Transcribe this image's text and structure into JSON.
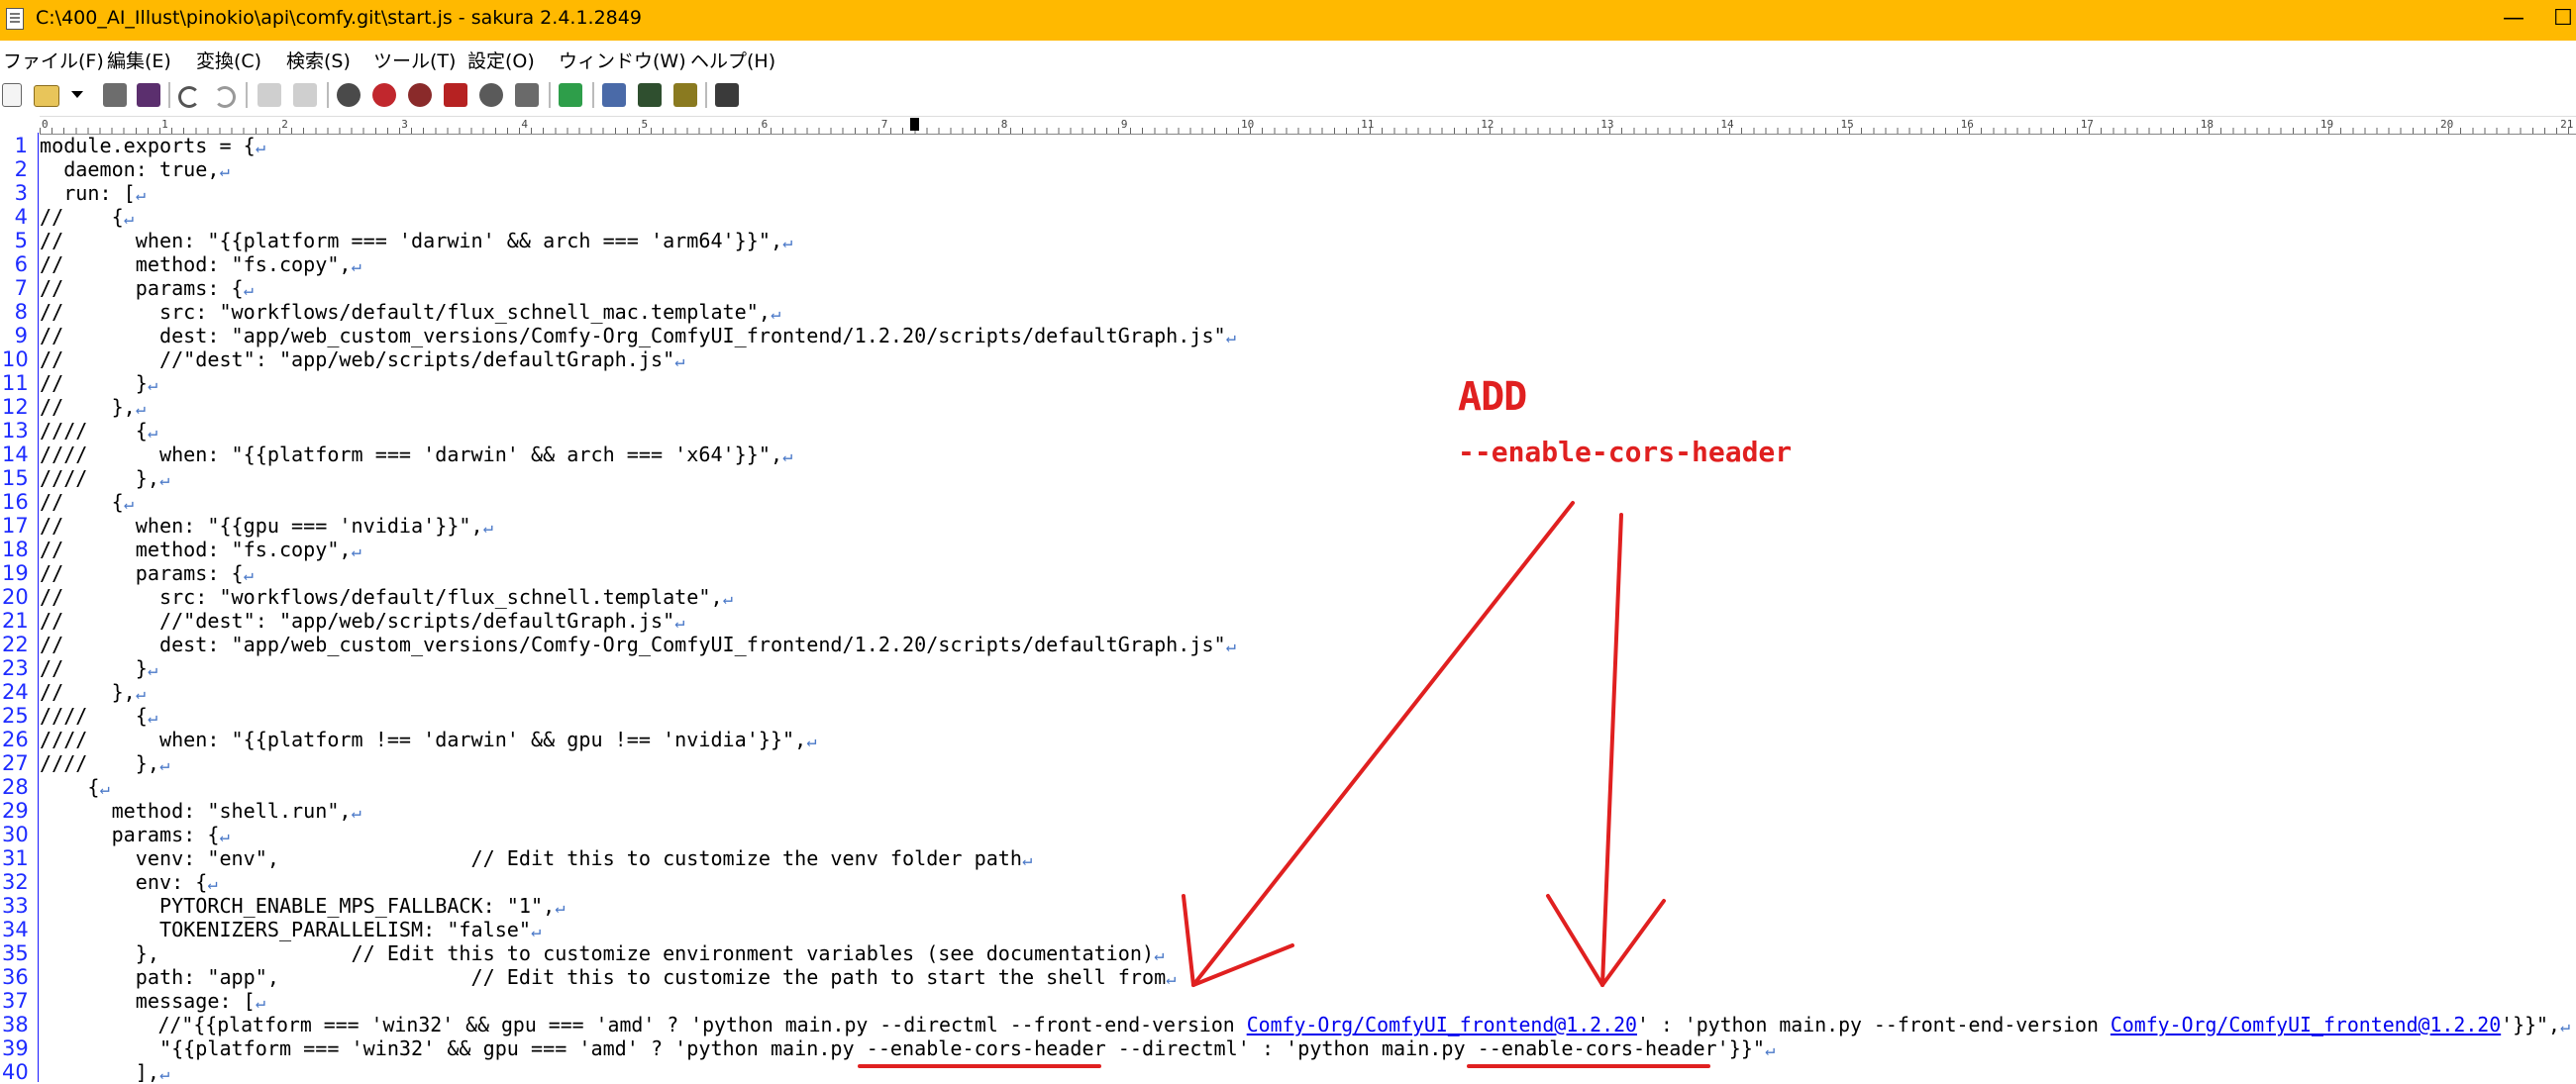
{
  "window": {
    "title": "C:\\400_AI_Illust\\pinokio\\api\\comfy.git\\start.js - sakura 2.4.1.2849",
    "minimize": "—",
    "maximize": "☐"
  },
  "menu": [
    "ファイル(F)",
    "編集(E)",
    "変換(C)",
    "検索(S)",
    "ツール(T)",
    "設定(O)",
    "ウィンドウ(W)",
    "ヘルプ(H)"
  ],
  "ruler_labels": [
    "0",
    "1",
    "2",
    "3",
    "4",
    "5",
    "6",
    "7",
    "8",
    "9",
    "10",
    "11",
    "12",
    "13",
    "14",
    "15",
    "16",
    "17",
    "18",
    "19",
    "20",
    "21"
  ],
  "toolbar_icons": [
    "new-file-icon",
    "open-folder-icon",
    "dropdown-arrow-icon",
    "save-icon",
    "save-all-icon",
    "undo-icon",
    "redo-icon",
    "jump-back-icon",
    "jump-forward-icon",
    "search-icon",
    "search-prev-icon",
    "search-next-icon",
    "replace-icon",
    "search-clear-icon",
    "grep-icon",
    "outline-icon",
    "compare-icon",
    "tag-jump-icon",
    "settings-icon"
  ],
  "lines": [
    {
      "n": "1",
      "t": "module.exports = {"
    },
    {
      "n": "2",
      "t": "  daemon: true,"
    },
    {
      "n": "3",
      "t": "  run: ["
    },
    {
      "n": "4",
      "t": "//    {"
    },
    {
      "n": "5",
      "t": "//      when: \"{{platform === 'darwin' && arch === 'arm64'}}\","
    },
    {
      "n": "6",
      "t": "//      method: \"fs.copy\","
    },
    {
      "n": "7",
      "t": "//      params: {"
    },
    {
      "n": "8",
      "t": "//        src: \"workflows/default/flux_schnell_mac.template\","
    },
    {
      "n": "9",
      "t": "//        dest: \"app/web_custom_versions/Comfy-Org_ComfyUI_frontend/1.2.20/scripts/defaultGraph.js\""
    },
    {
      "n": "10",
      "t": "//        //\"dest\": \"app/web/scripts/defaultGraph.js\""
    },
    {
      "n": "11",
      "t": "//      }"
    },
    {
      "n": "12",
      "t": "//    },"
    },
    {
      "n": "13",
      "t": "////    {"
    },
    {
      "n": "14",
      "t": "////      when: \"{{platform === 'darwin' && arch === 'x64'}}\","
    },
    {
      "n": "15",
      "t": "////    },"
    },
    {
      "n": "16",
      "t": "//    {"
    },
    {
      "n": "17",
      "t": "//      when: \"{{gpu === 'nvidia'}}\","
    },
    {
      "n": "18",
      "t": "//      method: \"fs.copy\","
    },
    {
      "n": "19",
      "t": "//      params: {"
    },
    {
      "n": "20",
      "t": "//        src: \"workflows/default/flux_schnell.template\","
    },
    {
      "n": "21",
      "t": "//        //\"dest\": \"app/web/scripts/defaultGraph.js\""
    },
    {
      "n": "22",
      "t": "//        dest: \"app/web_custom_versions/Comfy-Org_ComfyUI_frontend/1.2.20/scripts/defaultGraph.js\""
    },
    {
      "n": "23",
      "t": "//      }"
    },
    {
      "n": "24",
      "t": "//    },"
    },
    {
      "n": "25",
      "t": "////    {"
    },
    {
      "n": "26",
      "t": "////      when: \"{{platform !== 'darwin' && gpu !== 'nvidia'}}\","
    },
    {
      "n": "27",
      "t": "////    },"
    },
    {
      "n": "28",
      "t": "    {"
    },
    {
      "n": "29",
      "t": "      method: \"shell.run\","
    },
    {
      "n": "30",
      "t": "      params: {"
    },
    {
      "n": "31",
      "t": "        venv: \"env\",                // Edit this to customize the venv folder path"
    },
    {
      "n": "32",
      "t": "        env: {"
    },
    {
      "n": "33",
      "t": "          PYTORCH_ENABLE_MPS_FALLBACK: \"1\","
    },
    {
      "n": "34",
      "t": "          TOKENIZERS_PARALLELISM: \"false\""
    },
    {
      "n": "35",
      "t": "        },                // Edit this to customize environment variables (see documentation)"
    },
    {
      "n": "36",
      "t": "        path: \"app\",                // Edit this to customize the path to start the shell from"
    },
    {
      "n": "37",
      "t": "        message: ["
    },
    {
      "n": "38",
      "p": [
        "          //\"{{platform === 'win32' && gpu === 'amd' ? 'python main.py --directml --front-end-version ",
        "Comfy-Org/ComfyUI_frontend@1.2.20",
        "' : 'python main.py --front-end-version ",
        "Comfy-Org/ComfyUI_frontend@1.2.20",
        "'}}\","
      ]
    },
    {
      "n": "39",
      "t": "          \"{{platform === 'win32' && gpu === 'amd' ? 'python main.py --enable-cors-header --directml' : 'python main.py --enable-cors-header'}}\""
    },
    {
      "n": "40",
      "t": "        ],"
    }
  ],
  "eol_mark": "↵",
  "annotation": {
    "title": "ADD",
    "text": "--enable-cors-header",
    "color": "#e02020"
  },
  "colors": {
    "titlebar": "#ffb900",
    "line_numbers": "#1e2cff",
    "eol": "#4a78c8",
    "link": "#0000ee"
  }
}
